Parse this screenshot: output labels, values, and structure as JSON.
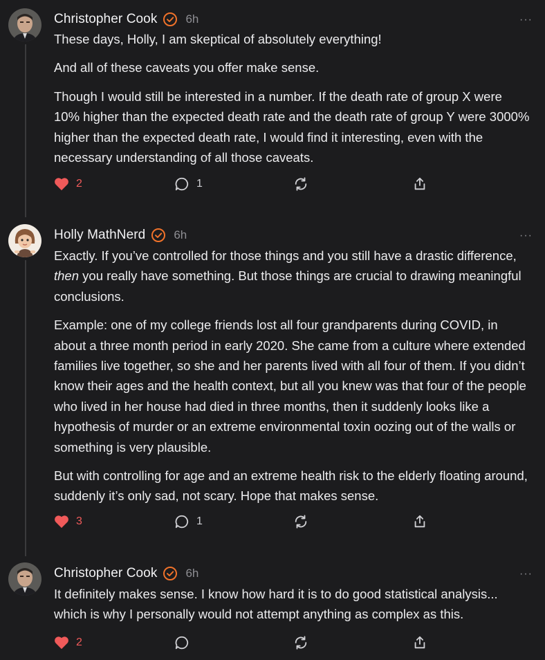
{
  "comments": [
    {
      "author": "Christopher Cook",
      "time": "6h",
      "more": "···",
      "avatar": "avatar-man",
      "paragraphs": [
        "These days, Holly, I am skeptical of absolutely everything!",
        "And all of these caveats you offer make sense.",
        "Though I would still be interested in a number. If the death rate of group X were 10% higher than the expected death rate and the death rate of group Y were 3000% higher than the expected death rate, I would find it interesting, even with the necessary understanding of all those caveats."
      ],
      "likes": "2",
      "replies": "1"
    },
    {
      "author": "Holly MathNerd",
      "time": "6h",
      "more": "···",
      "avatar": "avatar-woman",
      "paragraphs": [
        "Exactly. If you’ve controlled for those things and you still have a drastic difference, <em>then</em> you really have something. But those things are crucial to drawing meaningful conclusions.",
        "Example: one of my college friends lost all four grandparents during COVID, in about a three month period in early 2020. She came from a culture where extended families live together, so she and her parents lived with all four of them. If you didn’t know their ages and the health context, but all you knew was that four of the people who lived in her house had died in three months, then it suddenly looks like a hypothesis of murder or an extreme environmental toxin oozing out of the walls or something is very plausible.",
        "But with controlling for age and an extreme health risk to the elderly floating around, suddenly it’s only sad, not scary. Hope that makes sense."
      ],
      "likes": "3",
      "replies": "1"
    },
    {
      "author": "Christopher Cook",
      "time": "6h",
      "more": "···",
      "avatar": "avatar-man",
      "paragraphs": [
        "It definitely makes sense. I know how hard it is to do good statistical analysis... which is why I personally would not attempt anything as complex as this."
      ],
      "likes": "2",
      "replies": ""
    }
  ],
  "colors": {
    "background": "#1c1c1e",
    "accent": "#f0722a",
    "like": "#f05a5a",
    "muted": "#8e8e93"
  },
  "icons": [
    "heart-icon",
    "comment-bubble-icon",
    "restack-icon",
    "share-icon",
    "verified-badge-icon",
    "more-options-icon"
  ]
}
